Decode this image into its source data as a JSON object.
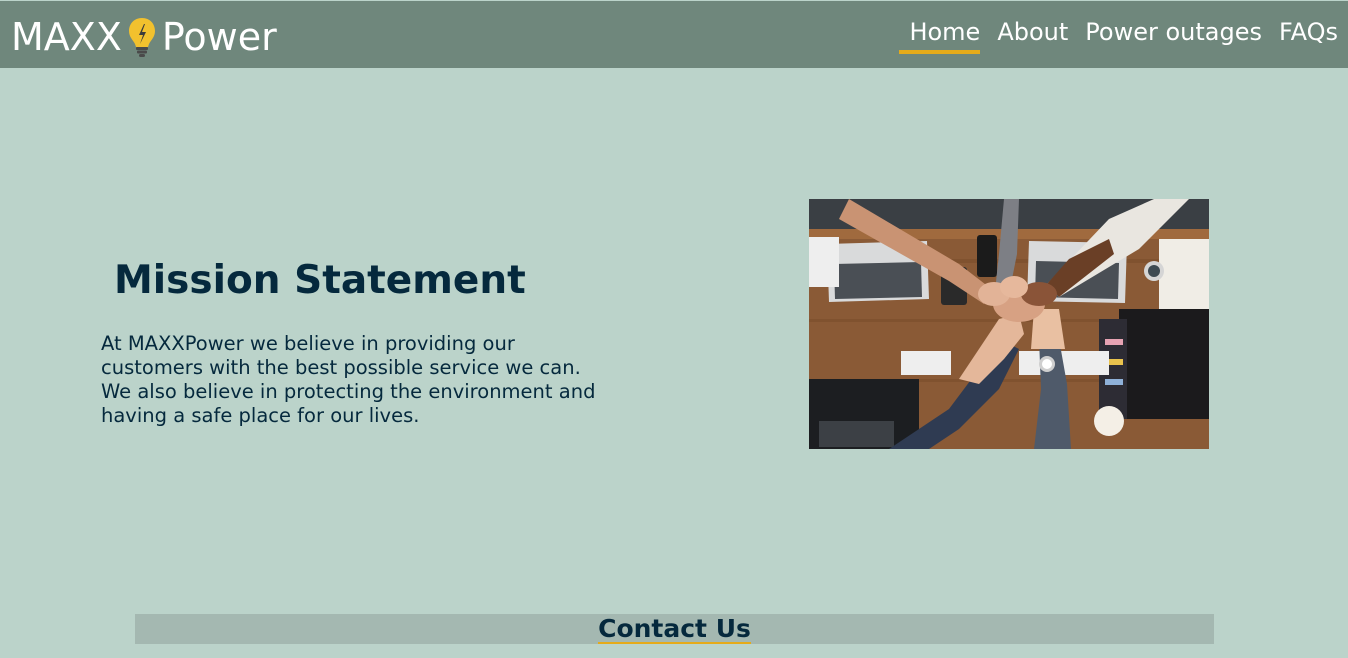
{
  "brand": {
    "name_part1": "MAXX",
    "name_part2": "Power",
    "logo_icon": "lightbulb-icon"
  },
  "nav": {
    "items": [
      {
        "label": "Home",
        "active": true
      },
      {
        "label": "About",
        "active": false
      },
      {
        "label": "Power outages",
        "active": false
      },
      {
        "label": "FAQs",
        "active": false
      }
    ]
  },
  "mission": {
    "title": "Mission Statement",
    "body": "At MAXXPower we believe in providing our customers with the best possible service we can. We also believe in protecting the environment and having a safe place for our lives."
  },
  "contact": {
    "title": "Contact Us"
  },
  "colors": {
    "nav_bg": "#6f877c",
    "page_bg": "#bbd3ca",
    "accent": "#e5ab1a",
    "heading_text": "#05293d",
    "contact_bg": "#a4b8b1"
  }
}
